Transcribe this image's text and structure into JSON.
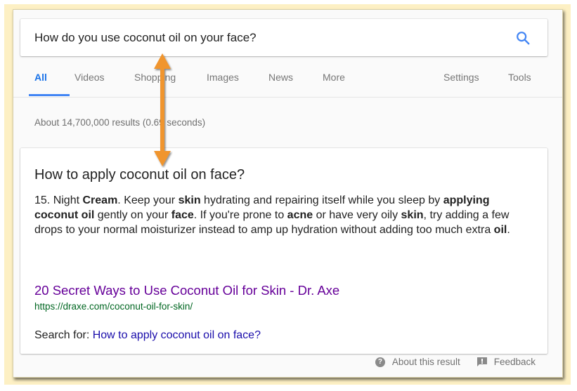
{
  "search": {
    "query": "How do you use coconut oil on your face?",
    "search_icon": "search-icon"
  },
  "tabs": [
    {
      "label": "All",
      "active": true
    },
    {
      "label": "Videos"
    },
    {
      "label": "Shopping"
    },
    {
      "label": "Images"
    },
    {
      "label": "News"
    },
    {
      "label": "More"
    },
    {
      "label": "Settings"
    },
    {
      "label": "Tools"
    }
  ],
  "stats": "About 14,700,000 results (0.69 seconds)",
  "snippet": {
    "question": "How to apply coconut oil on face?",
    "answer_segments": [
      {
        "text": "15. Night ",
        "bold": false
      },
      {
        "text": "Cream",
        "bold": true
      },
      {
        "text": ". Keep your ",
        "bold": false
      },
      {
        "text": "skin",
        "bold": true
      },
      {
        "text": " hydrating and repairing itself while you sleep by ",
        "bold": false
      },
      {
        "text": "applying coconut oil",
        "bold": true
      },
      {
        "text": " gently on your ",
        "bold": false
      },
      {
        "text": "face",
        "bold": true
      },
      {
        "text": ". If you're prone to ",
        "bold": false
      },
      {
        "text": "acne",
        "bold": true
      },
      {
        "text": " or have very oily ",
        "bold": false
      },
      {
        "text": "skin",
        "bold": true
      },
      {
        "text": ", try adding a few drops to your normal moisturizer instead to amp up hydration without adding too much extra ",
        "bold": false
      },
      {
        "text": "oil",
        "bold": true
      },
      {
        "text": ".",
        "bold": false
      }
    ],
    "result_title": "20 Secret Ways to Use Coconut Oil for Skin - Dr. Axe",
    "result_url": "https://draxe.com/coconut-oil-for-skin/",
    "search_for_label": "Search for: ",
    "search_for_link": "How to apply coconut oil on face?"
  },
  "footer": {
    "about_label": "About this result",
    "feedback_label": "Feedback"
  },
  "colors": {
    "accent_blue": "#4285f4",
    "visited_link": "#660099",
    "url_green": "#006621",
    "link_blue": "#1a0dab",
    "annotation_orange": "#f0952e",
    "frame_cream": "#fdf0c4"
  }
}
